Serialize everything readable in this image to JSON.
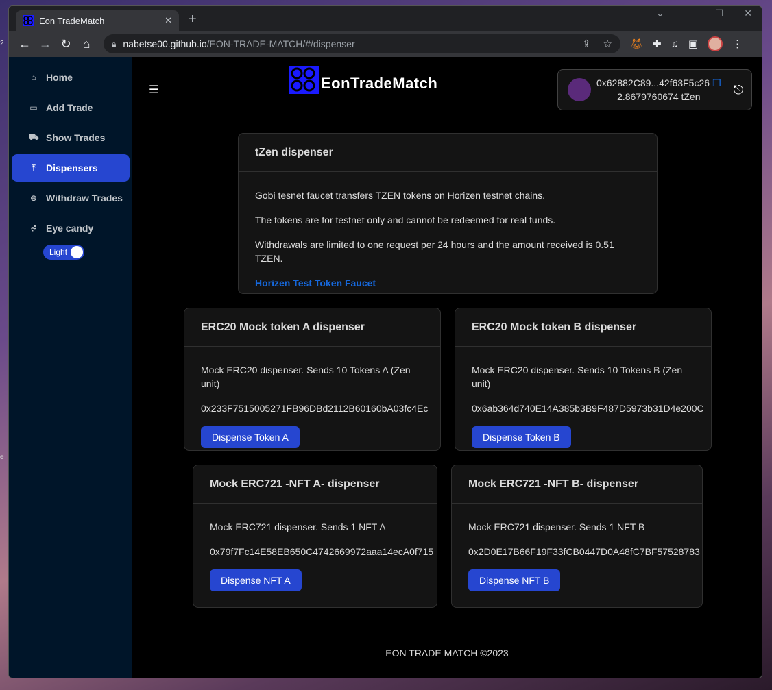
{
  "browser": {
    "tab_title": "Eon TradeMatch",
    "url_host": "nabetse00.github.io",
    "url_path": "/EON-TRADE-MATCH/#/dispenser"
  },
  "sidebar": {
    "items": [
      {
        "label": "Home",
        "icon": "home-icon"
      },
      {
        "label": "Add Trade",
        "icon": "card-icon"
      },
      {
        "label": "Show Trades",
        "icon": "cart-icon"
      },
      {
        "label": "Dispensers",
        "icon": "upload-icon",
        "active": true
      },
      {
        "label": "Withdraw Trades",
        "icon": "logout-icon"
      },
      {
        "label": "Eye candy",
        "icon": "chart-icon"
      }
    ],
    "theme_toggle_label": "Light"
  },
  "header": {
    "logo_text": "EonTradeMatch",
    "wallet_address": "0x62882C89...42f63F5c26",
    "wallet_balance": "2.8679760674 tZen"
  },
  "tzen_card": {
    "title": "tZen dispenser",
    "line1": "Gobi tesnet faucet transfers TZEN tokens on Horizen testnet chains.",
    "line2": "The tokens are for testnet only and cannot be redeemed for real funds.",
    "line3": "Withdrawals are limited to one request per 24 hours and the amount received is 0.51 TZEN.",
    "link": "Horizen Test Token Faucet"
  },
  "erc20_a": {
    "title": "ERC20 Mock token A dispenser",
    "description": "Mock ERC20 dispenser. Sends 10 Tokens A (Zen unit)",
    "address": "0x233F7515005271FB96DBd2112B60160bA03fc4Ec",
    "button": "Dispense Token A"
  },
  "erc20_b": {
    "title": "ERC20 Mock token B dispenser",
    "description": "Mock ERC20 dispenser. Sends 10 Tokens B (Zen unit)",
    "address": "0x6ab364d740E14A385b3B9F487D5973b31D4e200C",
    "button": "Dispense Token B"
  },
  "erc721_a": {
    "title": "Mock ERC721 -NFT A- dispenser",
    "description": "Mock ERC721 dispenser. Sends 1 NFT A",
    "address": "0x79f7Fc14E58EB650C4742669972aaa14ecA0f715",
    "button": "Dispense NFT A"
  },
  "erc721_b": {
    "title": "Mock ERC721 -NFT B- dispenser",
    "description": "Mock ERC721 dispenser. Sends 1 NFT B",
    "address": "0x2D0E17B66F19F33fCB0447D0A48fC7BF57528783",
    "button": "Dispense NFT B"
  },
  "footer": {
    "text": "EON TRADE MATCH ©2023"
  },
  "colors": {
    "accent": "#2646d0",
    "link": "#1668dc",
    "sider": "#001529",
    "card_bg": "#141414"
  }
}
